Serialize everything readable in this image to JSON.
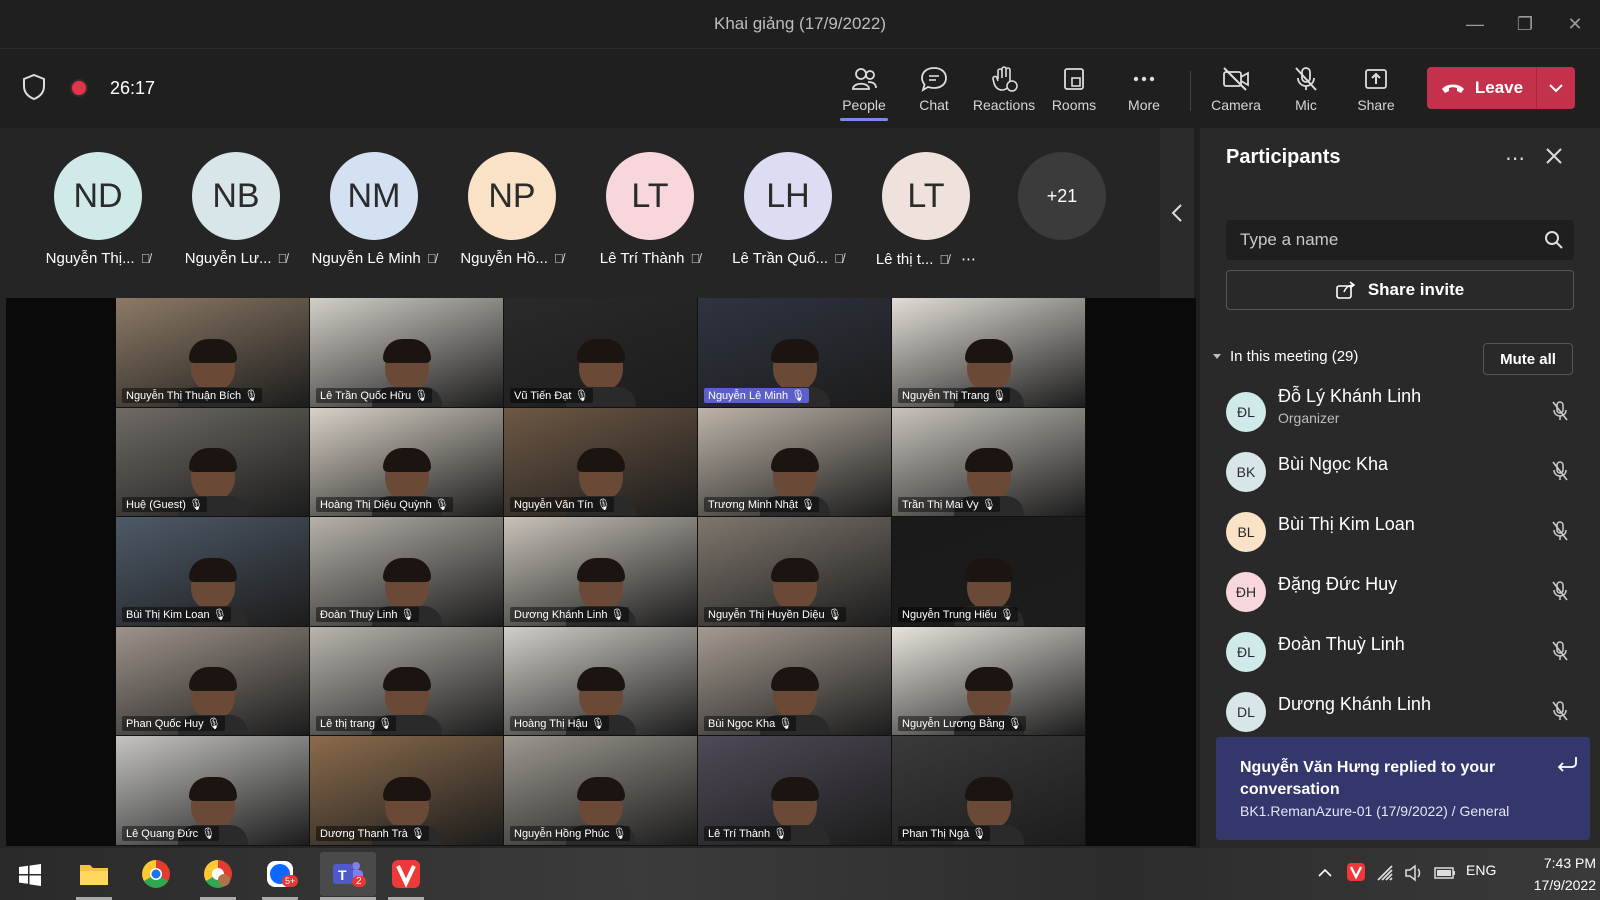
{
  "window": {
    "title": "Khai giảng (17/9/2022)"
  },
  "toolbar": {
    "timer": "26:17",
    "buttons": [
      {
        "label": "People",
        "icon": "people-icon"
      },
      {
        "label": "Chat",
        "icon": "chat-icon"
      },
      {
        "label": "Reactions",
        "icon": "reactions-icon"
      },
      {
        "label": "Rooms",
        "icon": "rooms-icon"
      },
      {
        "label": "More",
        "icon": "more-icon"
      },
      {
        "label": "Camera",
        "icon": "camera-off-icon"
      },
      {
        "label": "Mic",
        "icon": "mic-off-icon"
      },
      {
        "label": "Share",
        "icon": "share-icon"
      }
    ],
    "leave_label": "Leave",
    "leave_color": "#c4314b"
  },
  "gallery": {
    "avatars": [
      {
        "initials": "ND",
        "name": "Nguyễn Thị...",
        "color": "#cfeae8"
      },
      {
        "initials": "NB",
        "name": "Nguyễn Lư...",
        "color": "#d8e6ea"
      },
      {
        "initials": "NM",
        "name": "Nguyễn Lê Minh",
        "color": "#d3e1f2"
      },
      {
        "initials": "NP",
        "name": "Nguyễn Hồ...",
        "color": "#f9e2c6"
      },
      {
        "initials": "LT",
        "name": "Lê Trí Thành",
        "color": "#f8d7dc"
      },
      {
        "initials": "LH",
        "name": "Lê Trần Quố...",
        "color": "#dcdcf2"
      },
      {
        "initials": "LT",
        "name": "Lê thị t...",
        "color": "#efe1dc"
      }
    ],
    "overflow": "+21"
  },
  "videos": [
    "Nguyễn Thị Thuận Bích",
    "Lê Trần Quốc Hữu",
    "Vũ Tiến Đạt",
    "Nguyễn Lê Minh",
    "Nguyễn Thị Trang",
    "Huệ (Guest)",
    "Hoàng Thị Diệu Quỳnh",
    "Nguyễn Văn Tín",
    "Trương Minh Nhật",
    "Trần Thị Mai Vy",
    "Bùi Thị Kim Loan",
    "Đoàn Thuỳ Linh",
    "Dương Khánh Linh",
    "Nguyễn Thị Huyền Diệu",
    "Nguyễn Trung Hiếu",
    "Phan Quốc Huy",
    "Lê thị trang",
    "Hoàng Thị Hậu",
    "Bùi Ngọc Kha",
    "Nguyễn Lương Bằng",
    "Lê Quang Đức",
    "Dương Thanh Trà",
    "Nguyễn Hồng Phúc",
    "Lê Trí Thành",
    "Phan Thị Ngà"
  ],
  "panel": {
    "title": "Participants",
    "search_placeholder": "Type a name",
    "share_invite": "Share invite",
    "section_label": "In this meeting (29)",
    "mute_all": "Mute all",
    "participants": [
      {
        "initials": "ĐL",
        "name": "Đỗ Lý Khánh Linh",
        "role": "Organizer",
        "color": "#cfeae8"
      },
      {
        "initials": "BK",
        "name": "Bùi Ngọc Kha",
        "role": "",
        "color": "#d8e6ea"
      },
      {
        "initials": "BL",
        "name": "Bùi Thị Kim Loan",
        "role": "",
        "color": "#f9e2c6"
      },
      {
        "initials": "ĐH",
        "name": "Đặng Đức Huy",
        "role": "",
        "color": "#f8d7dc"
      },
      {
        "initials": "ĐL",
        "name": "Đoàn Thuỳ Linh",
        "role": "",
        "color": "#cfeae8"
      },
      {
        "initials": "DL",
        "name": "Dương Khánh Linh",
        "role": "",
        "color": "#d8e6ea"
      }
    ]
  },
  "toast": {
    "title": "Nguyễn Văn Hưng replied to your conversation",
    "subtitle": "BK1.RemanAzure-01 (17/9/2022) / General"
  },
  "taskbar": {
    "language": "ENG",
    "time": "7:43 PM",
    "date": "17/9/2022",
    "zalo_badge": "5+",
    "teams_badge": "2"
  }
}
